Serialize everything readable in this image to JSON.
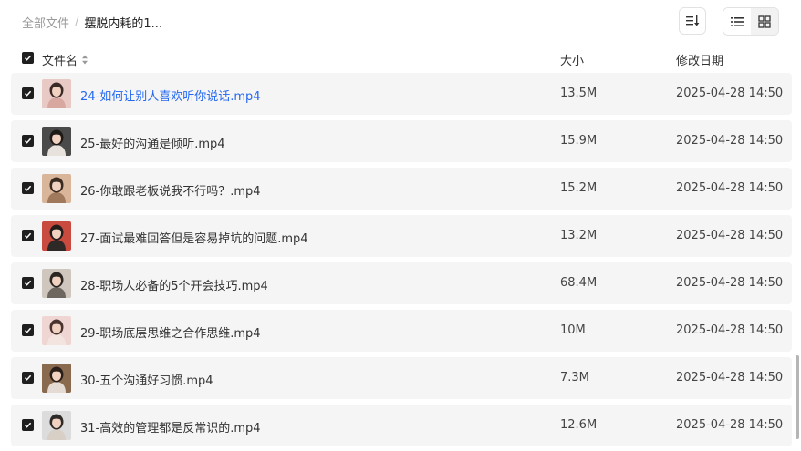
{
  "breadcrumb": {
    "root": "全部文件",
    "separator": "/",
    "current": "摆脱内耗的1..."
  },
  "header": {
    "name": "文件名",
    "size": "大小",
    "date": "修改日期"
  },
  "files": [
    {
      "name": "24-如何让别人喜欢听你说话.mp4",
      "size": "13.5M",
      "date": "2025-04-28 14:50",
      "thumb": {
        "bg": "#e9c9c4",
        "hair": "#3a2a26",
        "cloth": "#d8a7a0"
      }
    },
    {
      "name": "25-最好的沟通是倾听.mp4",
      "size": "15.9M",
      "date": "2025-04-28 14:50",
      "thumb": {
        "bg": "#4a4a4a",
        "hair": "#1e1a18",
        "cloth": "#e8e2dc"
      }
    },
    {
      "name": "26-你敢跟老板说我不行吗？.mp4",
      "size": "15.2M",
      "date": "2025-04-28 14:50",
      "thumb": {
        "bg": "#d9b59a",
        "hair": "#3b2a20",
        "cloth": "#a0785c"
      }
    },
    {
      "name": "27-面试最难回答但是容易掉坑的问题.mp4",
      "size": "13.2M",
      "date": "2025-04-28 14:50",
      "thumb": {
        "bg": "#c94a3e",
        "hair": "#231c1a",
        "cloth": "#2e2826"
      }
    },
    {
      "name": "28-职场人必备的5个开会技巧.mp4",
      "size": "68.4M",
      "date": "2025-04-28 14:50",
      "thumb": {
        "bg": "#cfc7bd",
        "hair": "#2c2622",
        "cloth": "#6e6760"
      }
    },
    {
      "name": "29-职场底层思维之合作思维.mp4",
      "size": "10M",
      "date": "2025-04-28 14:50",
      "thumb": {
        "bg": "#f0d6d2",
        "hair": "#4a3430",
        "cloth": "#f4e4e0"
      }
    },
    {
      "name": "30-五个沟通好习惯.mp4",
      "size": "7.3M",
      "date": "2025-04-28 14:50",
      "thumb": {
        "bg": "#8a6a4e",
        "hair": "#2a1e18",
        "cloth": "#e4dcd4"
      }
    },
    {
      "name": "31-高效的管理都是反常识的.mp4",
      "size": "12.6M",
      "date": "2025-04-28 14:50",
      "thumb": {
        "bg": "#dcdcdc",
        "hair": "#2e2a28",
        "cloth": "#d8cfc6"
      }
    }
  ],
  "icons": {
    "sort": "sort-lines-icon",
    "list_view": "list-view-icon",
    "grid_view": "grid-view-icon",
    "checkbox": "check-icon"
  },
  "colors": {
    "accent_link": "#2468f2",
    "row_bg": "#f5f5f5",
    "checkbox": "#1f1f1f"
  }
}
